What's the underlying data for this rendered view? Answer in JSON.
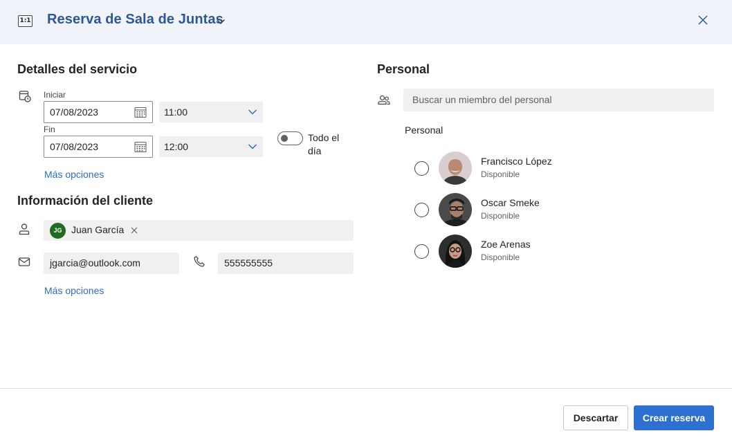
{
  "header": {
    "icon_text": "1:1",
    "title": "Reserva de Sala de Juntas"
  },
  "service_details": {
    "title": "Detalles del servicio",
    "start_label": "Iniciar",
    "start_date": "07/08/2023",
    "start_time": "11:00",
    "end_label": "Fin",
    "end_date": "07/08/2023",
    "end_time": "12:00",
    "all_day_label": "Todo el día",
    "all_day_on": false,
    "more_options": "Más opciones"
  },
  "customer_info": {
    "title": "Información del cliente",
    "customer_initials": "JG",
    "customer_name": "Juan García",
    "customer_avatar_color": "#1e6b21",
    "email": "jgarcia@outlook.com",
    "phone": "555555555",
    "more_options": "Más opciones"
  },
  "staff": {
    "title": "Personal",
    "search_placeholder": "Buscar un miembro del personal",
    "list_label": "Personal",
    "members": [
      {
        "name": "Francisco López",
        "status": "Disponible"
      },
      {
        "name": "Oscar Smeke",
        "status": "Disponible"
      },
      {
        "name": "Zoe Arenas",
        "status": "Disponible"
      }
    ]
  },
  "footer": {
    "discard_label": "Descartar",
    "create_label": "Crear reserva"
  },
  "colors": {
    "header_bg": "#f0f4fa",
    "title_blue": "#2b5797",
    "link_blue": "#2b6cc4",
    "primary_button": "#2e6fd2"
  }
}
